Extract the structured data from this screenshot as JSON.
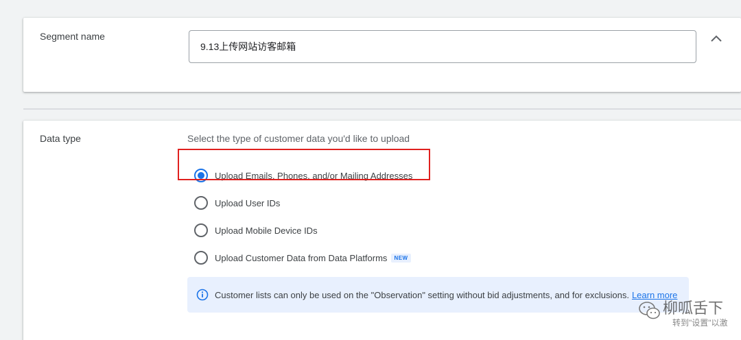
{
  "segment": {
    "label": "Segment name",
    "value": "9.13上传网站访客邮箱"
  },
  "data_type": {
    "label": "Data type",
    "prompt": "Select the type of customer data you'd like to upload",
    "options": [
      {
        "label": "Upload Emails, Phones, and/or Mailing Addresses",
        "selected": true
      },
      {
        "label": "Upload User IDs",
        "selected": false
      },
      {
        "label": "Upload Mobile Device IDs",
        "selected": false
      },
      {
        "label": "Upload Customer Data from Data Platforms",
        "selected": false,
        "badge": "NEW"
      }
    ],
    "info": {
      "text": "Customer lists can only be used on the \"Observation\" setting without bid adjustments, and for exclusions.",
      "link": "Learn more"
    }
  },
  "watermark": {
    "main": "柳呱舌下",
    "sub": "转到\"设置\"以激"
  },
  "colors": {
    "accent": "#1a73e8",
    "highlight": "#e0201e",
    "info_bg": "#e8f0fe"
  },
  "icons": [
    "chevron-up-icon",
    "info-icon",
    "wechat-icon"
  ]
}
